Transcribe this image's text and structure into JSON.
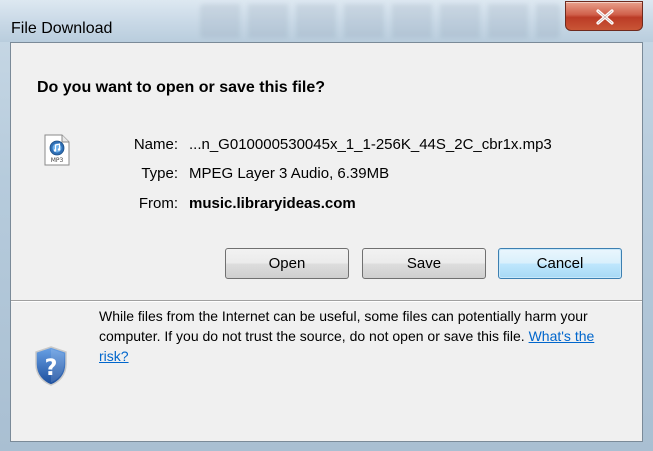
{
  "window": {
    "title": "File Download",
    "close_symbol": "X"
  },
  "dialog": {
    "question": "Do you want to open or save this file?",
    "file_icon": "mp3-file-icon",
    "file_icon_caption": "MP3",
    "name_label": "Name:",
    "name_value": "...n_G010000530045x_1_1-256K_44S_2C_cbr1x.mp3",
    "type_label": "Type:",
    "type_value": "MPEG Layer 3 Audio, 6.39MB",
    "from_label": "From:",
    "from_value": "music.libraryideas.com"
  },
  "buttons": {
    "open": "Open",
    "save": "Save",
    "cancel": "Cancel"
  },
  "warning": {
    "icon": "shield-question-icon",
    "text": "While files from the Internet can be useful, some files can potentially harm your computer. If you do not trust the source, do not open or save this file.",
    "link": "What's the risk?"
  },
  "colors": {
    "accent": "#0066cc",
    "close_button": "#c95636",
    "default_button_border": "#3c7fb1"
  }
}
